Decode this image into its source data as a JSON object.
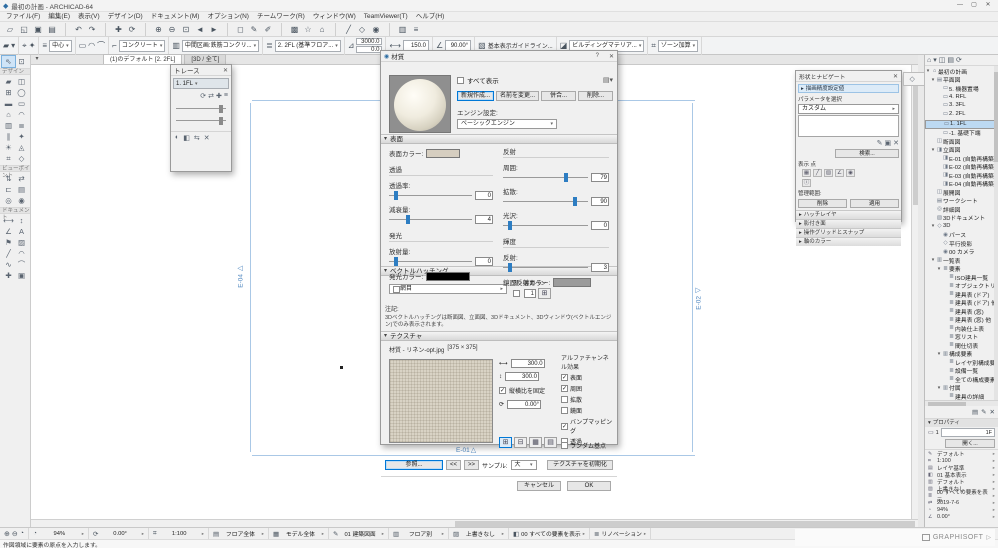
{
  "icons": {
    "app": "◆",
    "min": "—",
    "max": "▢",
    "close": "✕",
    "help": "?",
    "collapse": "▾",
    "expand": "▸",
    "chevron": "▸",
    "dropdown": "▾",
    "menu": "≡",
    "info": "ⓘ",
    "back": "<<",
    "fwd": ">>",
    "zoom_in": "⊕",
    "zoom_out": "⊖",
    "zoom_fit": "◔",
    "home": "⌂"
  },
  "window": {
    "title": "最初の計画 - ARCHICAD-64"
  },
  "menu": {
    "items": [
      "ファイル(F)",
      "編集(E)",
      "表示(V)",
      "デザイン(D)",
      "ドキュメント(M)",
      "オプション(N)",
      "チームワーク(R)",
      "ウィンドウ(W)",
      "TeamViewer(T)",
      "ヘルプ(H)"
    ]
  },
  "toolbar": {
    "icons": [
      {
        "name": "new-document-icon",
        "glyph": "▱"
      },
      {
        "name": "open-icon",
        "glyph": "◱"
      },
      {
        "name": "save-icon",
        "glyph": "▣"
      },
      {
        "name": "print-icon",
        "glyph": "▤"
      },
      {
        "name": "undo-icon",
        "glyph": "↶",
        "cls": "sep"
      },
      {
        "name": "redo-icon",
        "glyph": "↷"
      },
      {
        "name": "pan-icon",
        "glyph": "✚",
        "cls": "sep"
      },
      {
        "name": "orbit-icon",
        "glyph": "⟳"
      },
      {
        "name": "zoom-in-icon",
        "glyph": "⊕",
        "cls": "sep"
      },
      {
        "name": "zoom-out-icon",
        "glyph": "⊖"
      },
      {
        "name": "fit-view-icon",
        "glyph": "⊡"
      },
      {
        "name": "previous-view-icon",
        "glyph": "◄"
      },
      {
        "name": "next-view-icon",
        "glyph": "►"
      },
      {
        "name": "marquee-icon",
        "glyph": "◻",
        "cls": "sep"
      },
      {
        "name": "pick-up-parameters-icon",
        "glyph": "✎"
      },
      {
        "name": "inject-parameters-icon",
        "glyph": "✐"
      },
      {
        "name": "suspend-groups-icon",
        "glyph": "▩",
        "cls": "sep"
      },
      {
        "name": "magic-wand-icon",
        "glyph": "☆"
      },
      {
        "name": "gravity-icon",
        "glyph": "⌂"
      },
      {
        "name": "guide-lines-icon",
        "glyph": "╱",
        "cls": "sep"
      },
      {
        "name": "3d-view-icon",
        "glyph": "◇"
      },
      {
        "name": "render-icon",
        "glyph": "◉"
      },
      {
        "name": "layers-icon",
        "glyph": "▥",
        "cls": "sep"
      },
      {
        "name": "settings-icon",
        "glyph": "≡"
      }
    ]
  },
  "infobox": {
    "reference_value": "中心",
    "structure_value": "コンクリート",
    "composite_value": "中間区画:鉄筋コンクリ...",
    "floor_value": "2. 2FL (基準フロア...",
    "top_link_value": "3000.0",
    "base_offset_value": "0.0",
    "thickness_value": "150.0",
    "angle_value": "90.00°",
    "guide_value": "基本表示ガイドライン...",
    "material_value": "ビルディングマテリア...",
    "zone_value": "ゾーン加算"
  },
  "toolbox": {
    "select_tools": [
      {
        "name": "arrow-tool-icon",
        "glyph": "⇖",
        "cls": "on"
      },
      {
        "name": "marquee-tool-icon",
        "glyph": "⊡"
      }
    ],
    "sections": [
      {
        "label": "デザイン",
        "tools": [
          {
            "name": "wall-tool-icon",
            "glyph": "▰"
          },
          {
            "name": "door-tool-icon",
            "glyph": "◫"
          },
          {
            "name": "window-tool-icon",
            "glyph": "⊞"
          },
          {
            "name": "column-tool-icon",
            "glyph": "◯"
          },
          {
            "name": "beam-tool-icon",
            "glyph": "▬"
          },
          {
            "name": "slab-tool-icon",
            "glyph": "▭"
          },
          {
            "name": "roof-tool-icon",
            "glyph": "⌂"
          },
          {
            "name": "shell-tool-icon",
            "glyph": "◠"
          },
          {
            "name": "curtainwall-tool-icon",
            "glyph": "▥"
          },
          {
            "name": "stair-tool-icon",
            "glyph": "≣"
          },
          {
            "name": "railing-tool-icon",
            "glyph": "∥"
          },
          {
            "name": "object-tool-icon",
            "glyph": "✦"
          },
          {
            "name": "lamp-tool-icon",
            "glyph": "☀"
          },
          {
            "name": "mesh-tool-icon",
            "glyph": "◬"
          },
          {
            "name": "zone-tool-icon",
            "glyph": "⌗"
          },
          {
            "name": "morph-tool-icon",
            "glyph": "◇"
          }
        ]
      },
      {
        "label": "ビューポイント",
        "tools": [
          {
            "name": "section-tool-icon",
            "glyph": "⇅"
          },
          {
            "name": "elevation-tool-icon",
            "glyph": "⇄"
          },
          {
            "name": "interior-elevation-tool-icon",
            "glyph": "⊏"
          },
          {
            "name": "worksheet-tool-icon",
            "glyph": "▤"
          },
          {
            "name": "detail-tool-icon",
            "glyph": "◎"
          },
          {
            "name": "camera-tool-icon",
            "glyph": "◉"
          }
        ]
      },
      {
        "label": "ドキュメント",
        "tools": [
          {
            "name": "dimension-tool-icon",
            "glyph": "⟷"
          },
          {
            "name": "level-dimension-tool-icon",
            "glyph": "↕"
          },
          {
            "name": "angle-dimension-tool-icon",
            "glyph": "∠"
          },
          {
            "name": "text-tool-icon",
            "glyph": "A"
          },
          {
            "name": "label-tool-icon",
            "glyph": "⚑"
          },
          {
            "name": "fill-tool-icon",
            "glyph": "▨"
          },
          {
            "name": "line-tool-icon",
            "glyph": "╱"
          },
          {
            "name": "arc-tool-icon",
            "glyph": "◠"
          },
          {
            "name": "spline-tool-icon",
            "glyph": "∿"
          },
          {
            "name": "polyline-tool-icon",
            "glyph": "⌒"
          },
          {
            "name": "hotspot-tool-icon",
            "glyph": "✚"
          },
          {
            "name": "figure-tool-icon",
            "glyph": "▣"
          }
        ]
      }
    ]
  },
  "tabbar": {
    "tabs": [
      {
        "label": "(1)のデフォルト [2. 2FL]",
        "cls": "active"
      },
      {
        "label": "[3D / 全て]",
        "cls": ""
      }
    ]
  },
  "canvas": {
    "markers": {
      "e01": "E-01",
      "e02": "E-02",
      "e04": "E-04"
    }
  },
  "trace": {
    "title": "トレース",
    "ref_value": "1. 1FL",
    "top_icons": [
      {
        "name": "trace-rebuild-icon",
        "glyph": "⟳"
      },
      {
        "name": "trace-switch-icon",
        "glyph": "⇄"
      },
      {
        "name": "trace-move-icon",
        "glyph": "✚"
      },
      {
        "name": "trace-settings-icon",
        "glyph": "≡"
      }
    ],
    "bottom_icons": [
      {
        "name": "trace-fill-toggle-icon",
        "glyph": "◐"
      },
      {
        "name": "trace-splitter-icon",
        "glyph": "◧"
      },
      {
        "name": "trace-compare-icon",
        "glyph": "⇆"
      },
      {
        "name": "trace-close-icon",
        "glyph": "✕"
      }
    ]
  },
  "dialog": {
    "title": "材質",
    "show_all_label": "すべて表示",
    "new_button": "新規作成...",
    "rename_button": "名前を変更...",
    "merge_button": "併合...",
    "delete_button": "削除...",
    "engine_label": "エンジン設定:",
    "engine_value": "ベーシックエンジン",
    "surface_section": "表面",
    "surface_color_label": "表面カラー:",
    "surface_color": "#d6cec0",
    "transparency": {
      "header": "透過",
      "rows": [
        {
          "label": "透過率:",
          "value": "0",
          "style": "left:6%"
        },
        {
          "label": "減衰量:",
          "value": "4",
          "style": "left:20%"
        }
      ]
    },
    "emission": {
      "header": "発光",
      "rows": [
        {
          "label": "放射量:",
          "value": "0",
          "style": "left:6%"
        }
      ]
    },
    "emission_color_label": "発光カラー:",
    "emission_color": "#000000",
    "reflection": {
      "header": "反射",
      "rows": [
        {
          "label": "周囲:",
          "value": "79",
          "style": "left:72%"
        },
        {
          "label": "拡散:",
          "value": "90",
          "style": "left:82%"
        },
        {
          "label": "光沢:",
          "value": "0",
          "style": "left:6%"
        }
      ]
    },
    "highlight": {
      "header": "輝度",
      "rows": [
        {
          "label": "反射:",
          "value": "3",
          "style": "left:6%"
        }
      ]
    },
    "specular_color_label": "鏡面反射カラー:",
    "specular_color": "#9b9b9b",
    "hatch_section": "ベクトルハッチング",
    "hatch_value": "網目",
    "hatch_pen_label": "表・裏面ペン",
    "hatch_pen_value": "1",
    "note_label": "注記:",
    "note_text": "3Dベクトルハッチングは断面図、立面図、3Dドキュメント、3Dウィンドウ(ベクトルエンジン)でのみ表示されます。",
    "texture_section": "テクスチャ",
    "texture_name": "材質 - リネン-opt.jpg",
    "texture_size": "[375 × 375]",
    "width_value": "300.0",
    "height_value": "300.0",
    "keep_ratio_label": "縦横比を固定",
    "angle_value": "0.00°",
    "alpha_header": "アルファチャンネル効果",
    "alpha_options": [
      {
        "label": "表面",
        "mark": "✓"
      },
      {
        "label": "周囲",
        "mark": "✓"
      },
      {
        "label": "拡散",
        "mark": ""
      },
      {
        "label": "鏡面",
        "mark": ""
      },
      {
        "label": "バンプマッピング",
        "mark": "✓"
      },
      {
        "label": "透過",
        "mark": ""
      }
    ],
    "tiling_buttons": [
      {
        "name": "tile-repeat-icon",
        "glyph": "⊞",
        "cls": "on"
      },
      {
        "name": "tile-mirror-x-icon",
        "glyph": "⊟"
      },
      {
        "name": "tile-mirror-y-icon",
        "glyph": "▦"
      },
      {
        "name": "tile-single-icon",
        "glyph": "▤"
      }
    ],
    "random_origin_label": "ランダム基点",
    "browse_button": "参照...",
    "sample_label": "サンプル:",
    "sample_value": "大",
    "reset_button": "テクスチャを初期化",
    "cancel_button": "キャンセル",
    "ok_button": "OK"
  },
  "opts_panel": {
    "title": "形状とナビゲート",
    "tab_label": "描画精度設定値",
    "select_label": "パラメータを選択",
    "preset_value": "カスタム",
    "edit_icons": [
      {
        "name": "edit-pen-icon",
        "glyph": "✎"
      },
      {
        "name": "duplicate-icon",
        "glyph": "▣"
      },
      {
        "name": "remove-icon",
        "glyph": "✕"
      }
    ],
    "search_button": "検索...",
    "display_label": "表示 点",
    "grid_icons": [
      {
        "name": "display-dot-icon",
        "glyph": "▦"
      },
      {
        "name": "display-line-icon",
        "glyph": "╱"
      },
      {
        "name": "display-fill-icon",
        "glyph": "▨"
      },
      {
        "name": "display-axis-icon",
        "glyph": "∠"
      },
      {
        "name": "display-node-icon",
        "glyph": "◉"
      },
      {
        "name": "display-info-icon",
        "glyph": "ⓘ"
      }
    ],
    "manage_label": "管理範囲:",
    "delete_button": "削除",
    "apply_button": "適用",
    "sections": [
      {
        "label": "ハッチレイヤ"
      },
      {
        "label": "影付き面"
      },
      {
        "label": "操作グリッドとスナップ"
      },
      {
        "label": "軸のカラー"
      }
    ]
  },
  "minibar": {
    "icons": [
      {
        "name": "palette-dock-icon",
        "glyph": "◇"
      },
      {
        "name": "palette-collapse-icon",
        "glyph": "▽"
      },
      {
        "name": "palette-close-icon",
        "glyph": "✕"
      }
    ]
  },
  "navigator": {
    "top_icons": [
      {
        "name": "project-chooser-icon",
        "glyph": "⌂"
      },
      {
        "name": "project-dropdown-icon",
        "glyph": "▾"
      },
      {
        "name": "viewmap-icon",
        "glyph": "◫"
      },
      {
        "name": "layoutbook-icon",
        "glyph": "▤"
      },
      {
        "name": "publisher-icon",
        "glyph": "⟳"
      }
    ],
    "tree": [
      {
        "arrow": "▾",
        "icon": "⌂",
        "label": "最初の計画",
        "cls": ""
      },
      {
        "arrow": "▾",
        "icon": "▤",
        "label": "平面図",
        "cls": "lv1"
      },
      {
        "arrow": "",
        "icon": "▭",
        "label": "5. 機器置場",
        "cls": "lv2"
      },
      {
        "arrow": "",
        "icon": "▭",
        "label": "4. RFL",
        "cls": "lv2"
      },
      {
        "arrow": "",
        "icon": "▭",
        "label": "3. 3FL",
        "cls": "lv2"
      },
      {
        "arrow": "",
        "icon": "▭",
        "label": "2. 2FL",
        "cls": "lv2"
      },
      {
        "arrow": "",
        "icon": "▭",
        "label": "1. 1FL",
        "cls": "lv2 sel"
      },
      {
        "arrow": "",
        "icon": "▭",
        "label": "-1. 基礎下端",
        "cls": "lv2"
      },
      {
        "arrow": "",
        "icon": "◫",
        "label": "断面図",
        "cls": "lv1"
      },
      {
        "arrow": "▾",
        "icon": "◨",
        "label": "立面図",
        "cls": "lv1"
      },
      {
        "arrow": "",
        "icon": "◨",
        "label": "E-01 (自動再構築)",
        "cls": "lv2"
      },
      {
        "arrow": "",
        "icon": "◨",
        "label": "E-02 (自動再構築)",
        "cls": "lv2"
      },
      {
        "arrow": "",
        "icon": "◨",
        "label": "E-03 (自動再構築)",
        "cls": "lv2"
      },
      {
        "arrow": "",
        "icon": "◨",
        "label": "E-04 (自動再構築)",
        "cls": "lv2"
      },
      {
        "arrow": "",
        "icon": "◫",
        "label": "展開図",
        "cls": "lv1"
      },
      {
        "arrow": "",
        "icon": "▤",
        "label": "ワークシート",
        "cls": "lv1"
      },
      {
        "arrow": "",
        "icon": "◎",
        "label": "詳細図",
        "cls": "lv1"
      },
      {
        "arrow": "",
        "icon": "▧",
        "label": "3Dドキュメント",
        "cls": "lv1"
      },
      {
        "arrow": "▾",
        "icon": "◇",
        "label": "3D",
        "cls": "lv1"
      },
      {
        "arrow": "",
        "icon": "◉",
        "label": "パース",
        "cls": "lv2"
      },
      {
        "arrow": "",
        "icon": "◇",
        "label": "平行投影",
        "cls": "lv2"
      },
      {
        "arrow": "",
        "icon": "◉",
        "label": "00 カメラ",
        "cls": "lv2"
      },
      {
        "arrow": "▾",
        "icon": "▥",
        "label": "一覧表",
        "cls": "lv1"
      },
      {
        "arrow": "▾",
        "icon": "≣",
        "label": "要素",
        "cls": "lv2"
      },
      {
        "arrow": "",
        "icon": "≣",
        "label": "ISO建具一覧",
        "cls": "lv3"
      },
      {
        "arrow": "",
        "icon": "≣",
        "label": "オブジェクトリスト",
        "cls": "lv3"
      },
      {
        "arrow": "",
        "icon": "≣",
        "label": "建具表 (ドア)",
        "cls": "lv3"
      },
      {
        "arrow": "",
        "icon": "≣",
        "label": "建具表 (ドア) 他",
        "cls": "lv3"
      },
      {
        "arrow": "",
        "icon": "≣",
        "label": "建具表 (窓)",
        "cls": "lv3"
      },
      {
        "arrow": "",
        "icon": "≣",
        "label": "建具表 (窓) 他",
        "cls": "lv3"
      },
      {
        "arrow": "",
        "icon": "≣",
        "label": "内装仕上表",
        "cls": "lv3"
      },
      {
        "arrow": "",
        "icon": "≣",
        "label": "窓リスト",
        "cls": "lv3"
      },
      {
        "arrow": "",
        "icon": "≣",
        "label": "間仕切表",
        "cls": "lv3"
      },
      {
        "arrow": "▾",
        "icon": "▥",
        "label": "構成要素",
        "cls": "lv2"
      },
      {
        "arrow": "",
        "icon": "≣",
        "label": "レイヤ別構成要素",
        "cls": "lv3"
      },
      {
        "arrow": "",
        "icon": "≣",
        "label": "設備一覧",
        "cls": "lv3"
      },
      {
        "arrow": "",
        "icon": "≣",
        "label": "全ての構成要素",
        "cls": "lv3"
      },
      {
        "arrow": "▾",
        "icon": "▥",
        "label": "付属",
        "cls": "lv2"
      },
      {
        "arrow": "",
        "icon": "≣",
        "label": "建具の詳細",
        "cls": "lv3"
      }
    ],
    "bottom_icons": [
      {
        "name": "new-folder-icon",
        "glyph": "▤"
      },
      {
        "name": "edit-view-icon",
        "glyph": "✎"
      },
      {
        "name": "delete-view-icon",
        "glyph": "✕"
      }
    ],
    "props": {
      "header": "プロパティ",
      "id": "1",
      "name": "1F",
      "open_button": "開く...",
      "rows": [
        {
          "icon": "✎",
          "value": "デフォルト"
        },
        {
          "icon": "⌗",
          "value": "1:100"
        },
        {
          "icon": "▤",
          "value": "レイヤ基準"
        },
        {
          "icon": "◧",
          "value": "01 基本表示"
        },
        {
          "icon": "▥",
          "value": "デフォルト"
        },
        {
          "icon": "▨",
          "value": "上書きなし"
        },
        {
          "icon": "≣",
          "value": "00 すべての要素を表示"
        },
        {
          "icon": "⇄",
          "value": "2019-7-6"
        },
        {
          "icon": "◔",
          "value": "94%"
        },
        {
          "icon": "∠",
          "value": "0.00°"
        }
      ]
    }
  },
  "quickbar": {
    "segments": [
      {
        "icon": "◔",
        "value": "94%"
      },
      {
        "icon": "⟳",
        "value": "0.00°"
      },
      {
        "icon": "⌗",
        "value": "1:100"
      },
      {
        "icon": "▤",
        "value": "フロア全体"
      },
      {
        "icon": "▦",
        "value": "モデル全体"
      },
      {
        "icon": "✎",
        "value": "01 建築図面"
      },
      {
        "icon": "▥",
        "value": "フロア別"
      },
      {
        "icon": "▨",
        "value": "上書きなし"
      },
      {
        "icon": "◧",
        "value": "00 すべての要素を表示"
      },
      {
        "icon": "≣",
        "value": "リノベーション"
      }
    ]
  },
  "statusbar": {
    "prompt": "作図領域に要素の原点を入力します。"
  },
  "branding": {
    "name": "GRAPHISOFT",
    "arrow": "▷"
  }
}
